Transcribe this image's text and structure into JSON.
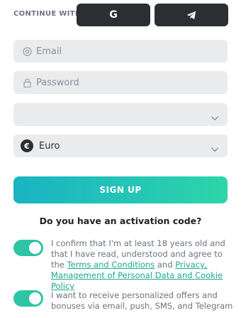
{
  "continue_with": {
    "label": "CONTINUE WITH",
    "google_label": "G",
    "telegram_icon": "telegram-icon"
  },
  "form": {
    "email_placeholder": "Email",
    "password_placeholder": "Password",
    "empty_select_value": "",
    "currency_value": "Euro",
    "currency_symbol": "€",
    "signup_label": "SIGN UP"
  },
  "activation_code_prompt": "Do you have an activation code?",
  "consents": {
    "age_text_before": "I confirm that I'm at least 18 years old and that I have read, understood and agree to the ",
    "terms_link": "Terms and Conditions",
    "and_text": " and ",
    "privacy_link": "Privacy, Management of Personal Data and Cookie Policy",
    "age_on": true,
    "offers_text": "I want to receive personalized offers and bonuses via email, push, SMS, and Telegram",
    "offers_on": true
  },
  "colors": {
    "accent_start": "#19b3c4",
    "accent_end": "#2ed5a9",
    "toggle_on": "#2ec4a6",
    "link": "#1aa88a",
    "dark_button": "#2b2e33",
    "field_bg": "#e9ebed"
  }
}
